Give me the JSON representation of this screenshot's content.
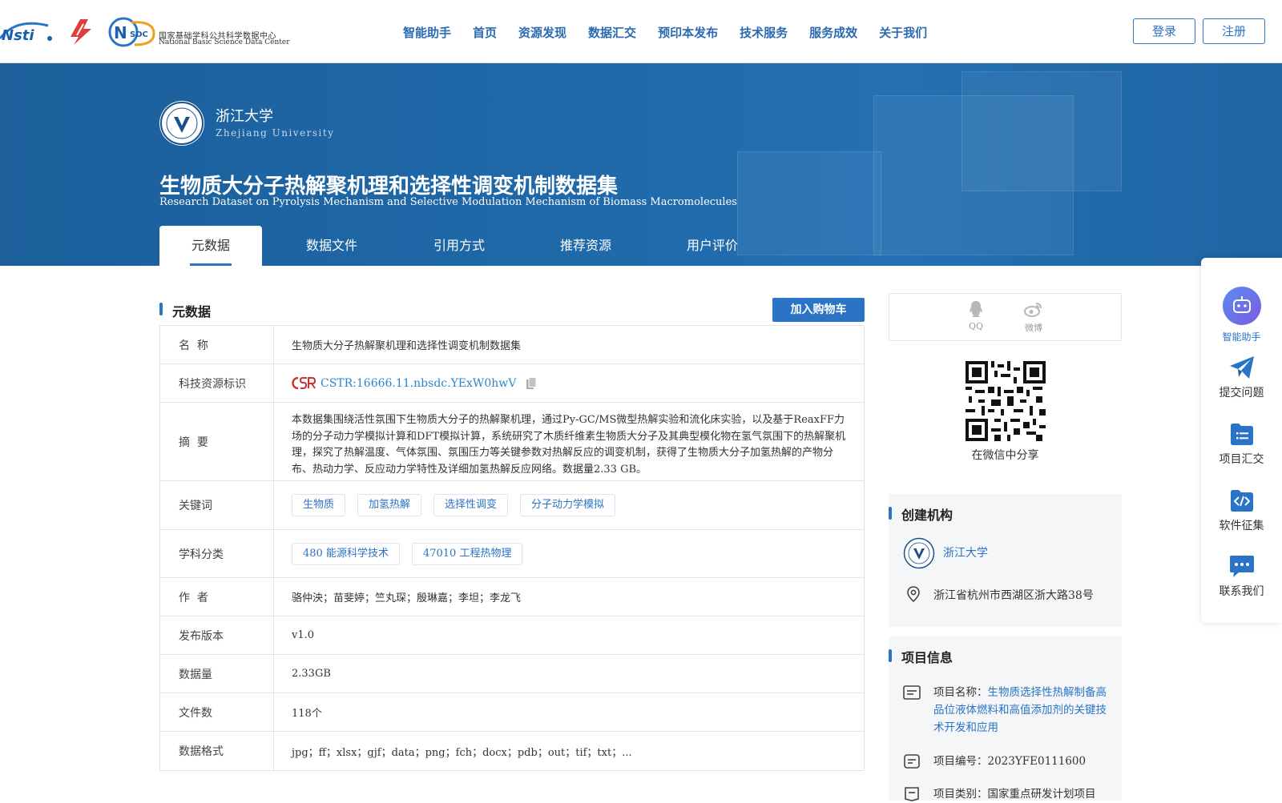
{
  "header": {
    "logos": [
      "istic-logo",
      "red-s-logo",
      "nsdc-logo"
    ],
    "nsdc_text_cn": "国家基础学科公共科学数据中心",
    "nsdc_text_en": "National Basic Science Data Center",
    "nav": [
      "智能助手",
      "首页",
      "资源发现",
      "数据汇交",
      "预印本发布",
      "技术服务",
      "服务成效",
      "关于我们"
    ],
    "login": "登录",
    "register": "注册"
  },
  "banner": {
    "university_cn": "浙江大学",
    "university_en": "Zhejiang University",
    "title": "生物质大分子热解聚机理和选择性调变机制数据集",
    "subtitle": "Research Dataset on Pyrolysis Mechanism and Selective Modulation Mechanism of Biomass Macromolecules",
    "tabs": [
      "元数据",
      "数据文件",
      "引用方式",
      "推荐资源",
      "用户评价"
    ],
    "active_tab": 0
  },
  "metadata": {
    "section_title": "元数据",
    "cart_button": "加入购物车",
    "rows": {
      "name_key": "名  称",
      "name_val": "生物质大分子热解聚机理和选择性调变机制数据集",
      "cstr_key": "科技资源标识",
      "cstr_val": "CSTR:16666.11.nbsdc.YExW0hwV",
      "abstract_key": "摘  要",
      "abstract_val": "本数据集围绕活性氛围下生物质大分子的热解聚机理，通过Py-GC/MS微型热解实验和流化床实验，以及基于ReaxFF力场的分子动力学模拟计算和DFT模拟计算，系统研究了木质纤维素生物质大分子及其典型模化物在氢气氛围下的热解聚机理，探究了热解温度、气体氛围、氛围压力等关键参数对热解反应的调变机制，获得了生物质大分子加氢热解的产物分布、热动力学、反应动力学特性及详细加氢热解反应网络。数据量2.33 GB。",
      "keywords_key": "关键词",
      "keywords": [
        "生物质",
        "加氢热解",
        "选择性调变",
        "分子动力学模拟"
      ],
      "subject_key": "学科分类",
      "subjects": [
        "480 能源科学技术",
        "47010 工程热物理"
      ],
      "author_key": "作  者",
      "author_val": "骆仲泱；苗斐婷；竺丸琛；殷琳嘉；李坦；李龙飞",
      "version_key": "发布版本",
      "version_val": "v1.0",
      "size_key": "数据量",
      "size_val": "2.33GB",
      "files_key": "文件数",
      "files_val": "118个",
      "format_key": "数据格式",
      "format_val": "jpg；ff；xlsx；gjf；data；png；fch；docx；pdb；out；tif；txt；..."
    }
  },
  "sidebar": {
    "share_qq": "QQ",
    "share_weibo": "微博",
    "qr_caption": "在微信中分享",
    "org_title": "创建机构",
    "org_name": "浙江大学",
    "org_address": "浙江省杭州市西湖区浙大路38号",
    "project_title": "项目信息",
    "project_name_label": "项目名称：",
    "project_name": "生物质选择性热解制备高品位液体燃料和高值添加剂的关键技术开发和应用",
    "project_no": "项目编号：2023YFE0111600",
    "project_type": "项目类别：国家重点研发计划项目"
  },
  "float_bar": {
    "items": [
      "智能助手",
      "提交问题",
      "项目汇交",
      "软件征集",
      "联系我们"
    ]
  },
  "colors": {
    "primary": "#2b73c4",
    "banner": "#1f69a9",
    "nav": "#2b6ab0"
  }
}
